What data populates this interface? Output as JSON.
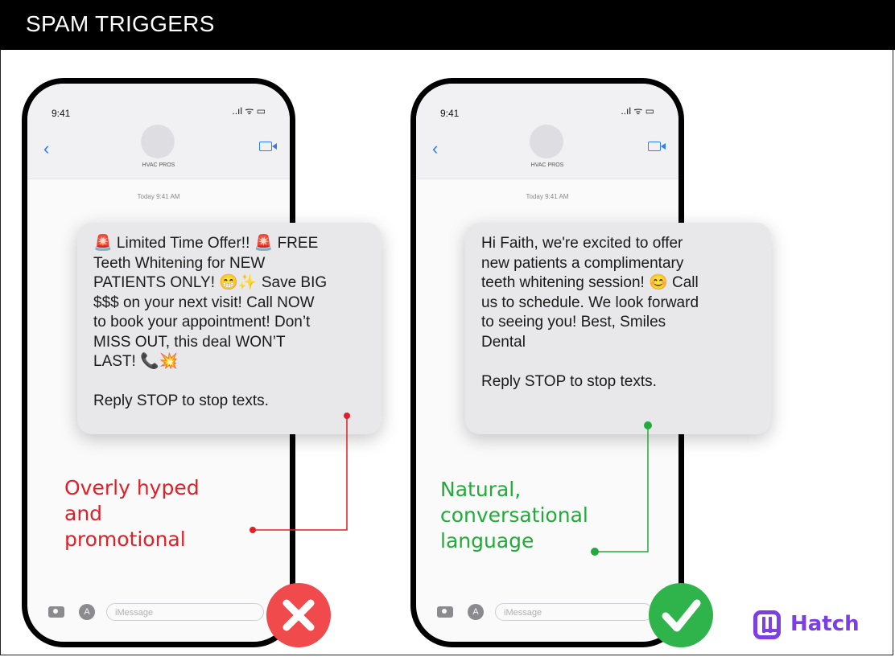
{
  "header": {
    "title": "SPAM TRIGGERS"
  },
  "phones": {
    "left": {
      "time": "9:41",
      "status": "..ıl ᯤ ▭",
      "contact": "HVAC PROS",
      "date": "Today 9:41 AM",
      "input_placeholder": "iMessage",
      "message_lines": [
        "🚨 Limited Time Offer!! 🚨 FREE",
        "Teeth Whitening for NEW",
        "PATIENTS ONLY! 😁✨ Save BIG",
        "$$$ on your next visit! Call NOW",
        "to book your appointment! Don’t",
        "MISS OUT, this deal WON’T",
        "LAST! 📞💥"
      ],
      "stop_text": "Reply STOP to stop texts.",
      "annotation_lines": [
        "Overly hyped",
        "and",
        "promotional"
      ],
      "annotation_color": "#e01f26",
      "badge": "x-icon",
      "badge_color": "#f04a4c"
    },
    "right": {
      "time": "9:41",
      "status": "..ıl ᯤ ▭",
      "contact": "HVAC PROS",
      "date": "Today 9:41 AM",
      "input_placeholder": "iMessage",
      "message_lines": [
        "Hi Faith, we're excited to offer",
        "new patients a complimentary",
        "teeth whitening session! 😊 Call",
        "us to schedule. We look forward",
        "to seeing you! Best, Smiles",
        "Dental"
      ],
      "stop_text": "Reply STOP to stop texts.",
      "annotation_lines": [
        "Natural,",
        "conversational",
        "language"
      ],
      "annotation_color": "#22aa3a",
      "badge": "check-icon",
      "badge_color": "#2eb44a"
    }
  },
  "logo": {
    "text": "Hatch",
    "color": "#7b3fe4"
  }
}
